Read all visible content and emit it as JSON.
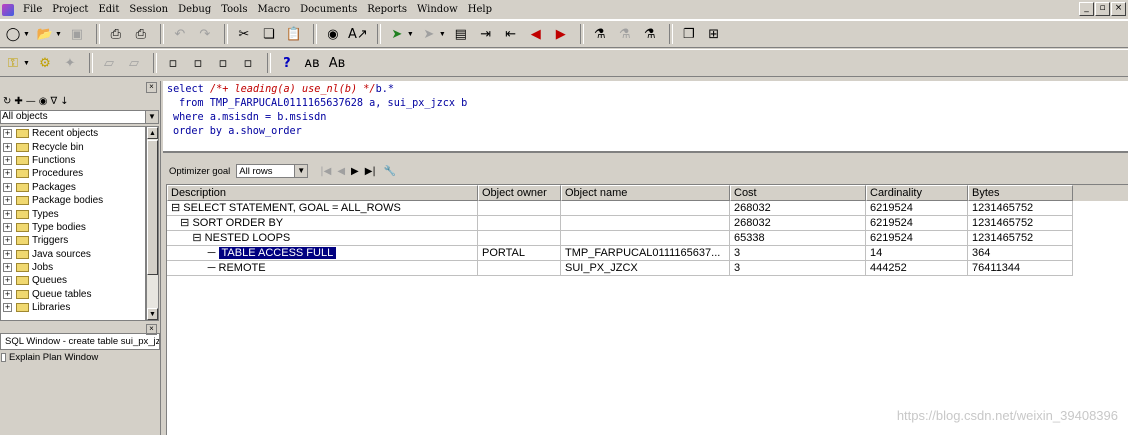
{
  "menu": [
    "File",
    "Project",
    "Edit",
    "Session",
    "Debug",
    "Tools",
    "Macro",
    "Documents",
    "Reports",
    "Window",
    "Help"
  ],
  "mdi_controls": [
    "_",
    "а",
    "×"
  ],
  "browser": {
    "filter_value": "All objects",
    "items": [
      "Recent objects",
      "Recycle bin",
      "Functions",
      "Procedures",
      "Packages",
      "Package bodies",
      "Types",
      "Type bodies",
      "Triggers",
      "Java sources",
      "Jobs",
      "Queues",
      "Queue tables",
      "Libraries"
    ]
  },
  "windows": [
    "SQL Window - create table sui_px_jzcx",
    "Explain Plan Window"
  ],
  "sql": {
    "line1_kw": "select",
    "line1_hint": "/*+ leading(a) use_nl(b) */",
    "line1_rest": "b.*",
    "line2_kw": "from",
    "line2_rest": "TMP_FARPUCAL0111165637628 a, sui_px_jzcx b",
    "line3_kw": "where",
    "line3_rest": "a.msisdn = b.msisdn",
    "line4_kw": "order by",
    "line4_rest": "a.show_order"
  },
  "plan": {
    "goal_label": "Optimizer goal",
    "goal_value": "All rows",
    "headers": [
      "Description",
      "Object owner",
      "Object name",
      "Cost",
      "Cardinality",
      "Bytes"
    ],
    "rows": [
      {
        "prefix": "⊟  ",
        "desc": "SELECT STATEMENT, GOAL = ALL_ROWS",
        "owner": "",
        "name": "",
        "cost": "268032",
        "card": "6219524",
        "bytes": "1231465752"
      },
      {
        "prefix": "   ⊟  ",
        "desc": "SORT ORDER BY",
        "owner": "",
        "name": "",
        "cost": "268032",
        "card": "6219524",
        "bytes": "1231465752"
      },
      {
        "prefix": "       ⊟  ",
        "desc": "NESTED LOOPS",
        "owner": "",
        "name": "",
        "cost": "65338",
        "card": "6219524",
        "bytes": "1231465752"
      },
      {
        "prefix": "            ─ ",
        "desc": "TABLE ACCESS FULL",
        "owner": "PORTAL",
        "name": "TMP_FARPUCAL0111165637...",
        "cost": "3",
        "card": "14",
        "bytes": "364"
      },
      {
        "prefix": "            ─ ",
        "desc": "REMOTE",
        "owner": "",
        "name": "SUI_PX_JZCX",
        "cost": "3",
        "card": "444252",
        "bytes": "76411344"
      }
    ]
  },
  "watermark": "https://blog.csdn.net/weixin_39408396"
}
